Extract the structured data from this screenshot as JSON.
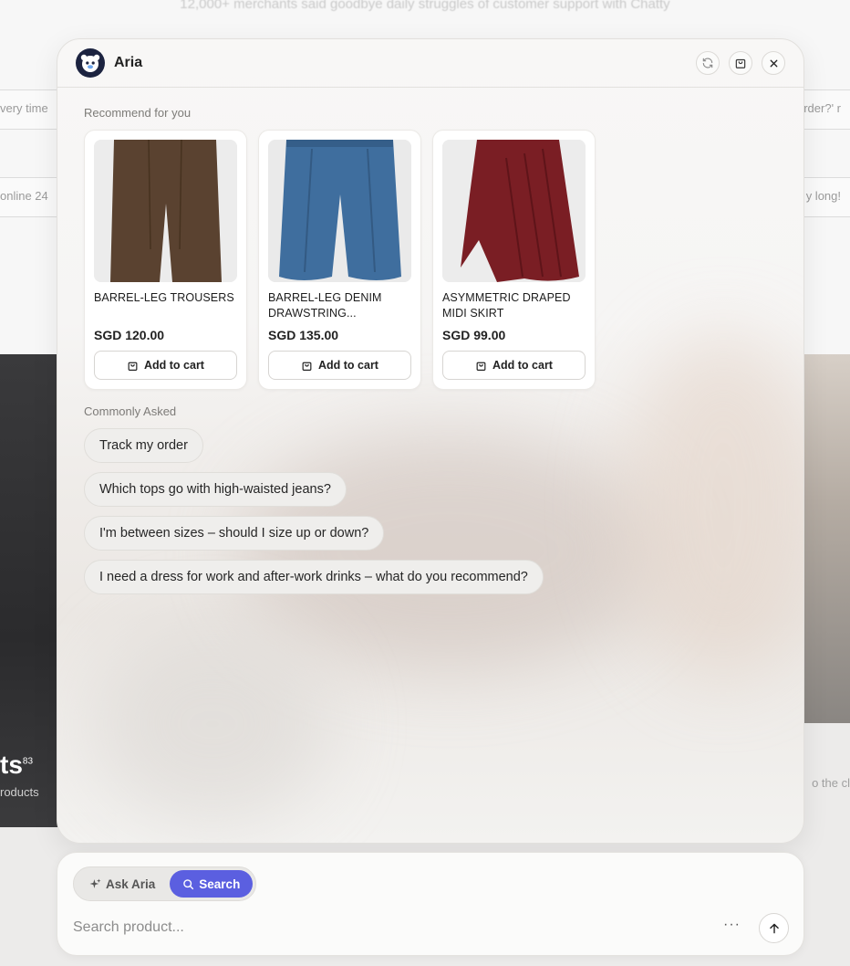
{
  "background": {
    "tagline": "12,000+ merchants said goodbye daily struggles of customer support with Chatty",
    "row1_left": "very time",
    "row1_right": "order?' r",
    "row2_left": "online 24",
    "row2_right": "y long!",
    "left_heading": "ts",
    "left_heading_sup": "83",
    "left_sub": "roducts",
    "right_sub": "o the cl"
  },
  "header": {
    "title": "Aria",
    "icons": [
      "aria-avatar-icon",
      "refresh-icon",
      "cart-icon",
      "close-icon"
    ]
  },
  "recommend": {
    "label": "Recommend for you",
    "products": [
      {
        "name": "BARREL-LEG TROUSERS",
        "price": "SGD 120.00",
        "button": "Add to cart",
        "color": "#5a4230"
      },
      {
        "name": "BARREL-LEG DENIM DRAWSTRING...",
        "price": "SGD 135.00",
        "button": "Add to cart",
        "color": "#3f6e9e"
      },
      {
        "name": "ASYMMETRIC DRAPED MIDI SKIRT",
        "price": "SGD 99.00",
        "button": "Add to cart",
        "color": "#7a1e24"
      }
    ]
  },
  "faq": {
    "label": "Commonly Asked",
    "items": [
      "Track my order",
      "Which tops go with high-waisted jeans?",
      "I'm between sizes – should I size up or down?",
      "I need a dress for work and after-work drinks – what do you recommend?"
    ]
  },
  "input": {
    "mode_ask": "Ask Aria",
    "mode_search": "Search",
    "active_mode": "Search",
    "placeholder": "Search product...",
    "more": "···",
    "accent": "#5b5fe0"
  }
}
